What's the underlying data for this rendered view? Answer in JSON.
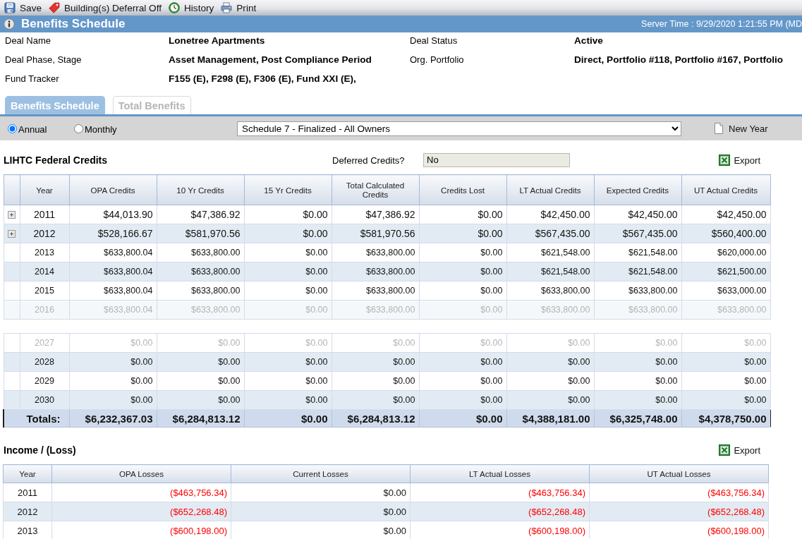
{
  "toolbar": {
    "items": [
      {
        "kind": "save",
        "label": "Save"
      },
      {
        "kind": "tag",
        "label": "Building(s) Deferral Off"
      },
      {
        "kind": "history",
        "label": "History"
      },
      {
        "kind": "print",
        "label": "Print"
      }
    ]
  },
  "header": {
    "title": "Benefits Schedule",
    "server_time": "Server Time : 9/29/2020 1:21:55 PM (MD"
  },
  "deal_info": [
    {
      "label": "Deal Name",
      "value": "Lonetree Apartments"
    },
    {
      "label": "Deal Status",
      "value": "Active"
    },
    {
      "label": "Deal Phase, Stage",
      "value": "Asset Management, Post Compliance Period"
    },
    {
      "label": "Org. Portfolio",
      "value": "Direct, Portfolio #118, Portfolio #167, Portfolio"
    },
    {
      "label": "Fund Tracker",
      "value": "F155 (E), F298 (E), F306 (E), Fund XXI (E),"
    }
  ],
  "tabs": [
    {
      "label": "Benefits Schedule",
      "selected": true
    },
    {
      "label": "Total Benefits",
      "selected": false
    }
  ],
  "options": {
    "periods": [
      {
        "label": "Annual",
        "selected": true
      },
      {
        "label": "Monthly",
        "selected": false
      }
    ],
    "schedule": "Schedule 7 - Finalized - All Owners",
    "new_year": "New Year"
  },
  "credits": {
    "title": "LIHTC Federal Credits",
    "deferred_label": "Deferred Credits?",
    "deferred_value": "No",
    "export": "Export",
    "columns": [
      "Year",
      "OPA Credits",
      "10 Yr Credits",
      "15 Yr Credits",
      "Total Calculated Credits",
      "Credits Lost",
      "LT Actual Credits",
      "Expected Credits",
      "UT Actual Credits"
    ],
    "rows": [
      {
        "kind": "row",
        "expandable": true,
        "faded": false,
        "year": "2011",
        "values": [
          "$44,013.90",
          "$47,386.92",
          "$0.00",
          "$47,386.92",
          "$0.00",
          "$42,450.00",
          "$42,450.00",
          "$42,450.00"
        ]
      },
      {
        "kind": "row",
        "expandable": true,
        "faded": false,
        "year": "2012",
        "values": [
          "$528,166.67",
          "$581,970.56",
          "$0.00",
          "$581,970.56",
          "$0.00",
          "$567,435.00",
          "$567,435.00",
          "$560,400.00"
        ]
      },
      {
        "kind": "row",
        "expandable": false,
        "faded": false,
        "year": "2013",
        "values": [
          "$633,800.04",
          "$633,800.00",
          "$0.00",
          "$633,800.00",
          "$0.00",
          "$621,548.00",
          "$621,548.00",
          "$620,000.00"
        ]
      },
      {
        "kind": "row",
        "expandable": false,
        "faded": false,
        "year": "2014",
        "values": [
          "$633,800.04",
          "$633,800.00",
          "$0.00",
          "$633,800.00",
          "$0.00",
          "$621,548.00",
          "$621,548.00",
          "$621,500.00"
        ]
      },
      {
        "kind": "row",
        "expandable": false,
        "faded": false,
        "year": "2015",
        "values": [
          "$633,800.04",
          "$633,800.00",
          "$0.00",
          "$633,800.00",
          "$0.00",
          "$633,800.00",
          "$633,800.00",
          "$633,000.00"
        ]
      },
      {
        "kind": "row",
        "expandable": false,
        "faded": true,
        "year": "2016",
        "values": [
          "$633,800.04",
          "$633,800.00",
          "$0.00",
          "$633,800.00",
          "$0.00",
          "$633,800.00",
          "$633,800.00",
          "$633,800.00"
        ]
      },
      {
        "kind": "gap"
      },
      {
        "kind": "row",
        "expandable": false,
        "faded": true,
        "year": "2027",
        "values": [
          "$0.00",
          "$0.00",
          "$0.00",
          "$0.00",
          "$0.00",
          "$0.00",
          "$0.00",
          "$0.00"
        ]
      },
      {
        "kind": "row",
        "expandable": false,
        "faded": false,
        "year": "2028",
        "values": [
          "$0.00",
          "$0.00",
          "$0.00",
          "$0.00",
          "$0.00",
          "$0.00",
          "$0.00",
          "$0.00"
        ]
      },
      {
        "kind": "row",
        "expandable": false,
        "faded": false,
        "year": "2029",
        "values": [
          "$0.00",
          "$0.00",
          "$0.00",
          "$0.00",
          "$0.00",
          "$0.00",
          "$0.00",
          "$0.00"
        ]
      },
      {
        "kind": "row",
        "expandable": false,
        "faded": false,
        "year": "2030",
        "values": [
          "$0.00",
          "$0.00",
          "$0.00",
          "$0.00",
          "$0.00",
          "$0.00",
          "$0.00",
          "$0.00"
        ]
      }
    ],
    "totals": {
      "label": "Totals:",
      "values": [
        "$6,232,367.03",
        "$6,284,813.12",
        "$0.00",
        "$6,284,813.12",
        "$0.00",
        "$4,388,181.00",
        "$6,325,748.00",
        "$4,378,750.00"
      ]
    }
  },
  "income": {
    "title": "Income / (Loss)",
    "export": "Export",
    "columns": [
      "Year",
      "OPA Losses",
      "Current Losses",
      "LT Actual Losses",
      "UT Actual Losses"
    ],
    "rows": [
      {
        "year": "2011",
        "values": [
          {
            "text": "($463,756.34)",
            "negative": true
          },
          {
            "text": "$0.00",
            "negative": false
          },
          {
            "text": "($463,756.34)",
            "negative": true
          },
          {
            "text": "($463,756.34)",
            "negative": true
          }
        ]
      },
      {
        "year": "2012",
        "values": [
          {
            "text": "($652,268.48)",
            "negative": true
          },
          {
            "text": "$0.00",
            "negative": false
          },
          {
            "text": "($652,268.48)",
            "negative": true
          },
          {
            "text": "($652,268.48)",
            "negative": true
          }
        ]
      },
      {
        "year": "2013",
        "values": [
          {
            "text": "($600,198.00)",
            "negative": true
          },
          {
            "text": "$0.00",
            "negative": false
          },
          {
            "text": "($600,198.00)",
            "negative": true
          },
          {
            "text": "($600,198.00)",
            "negative": true
          }
        ]
      }
    ]
  }
}
